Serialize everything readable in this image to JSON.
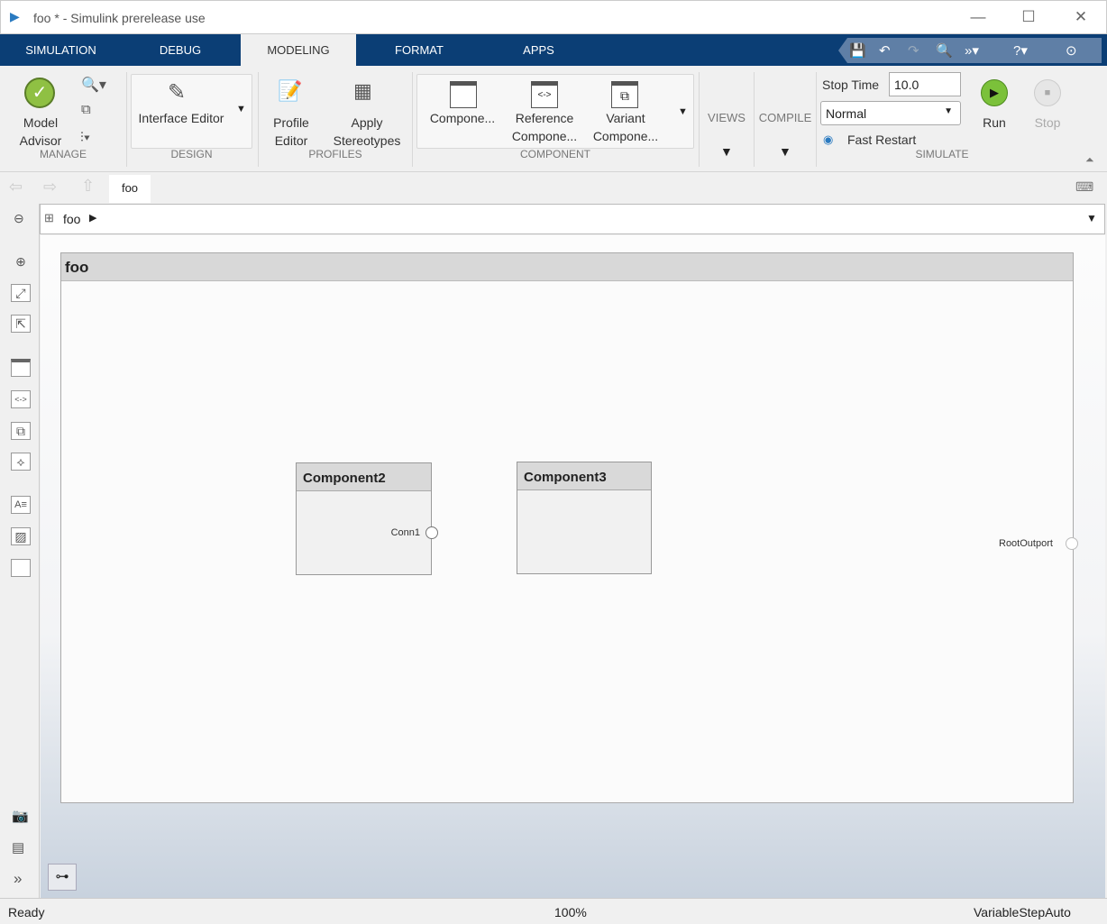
{
  "window": {
    "title": "foo * - Simulink prerelease use"
  },
  "tabs": [
    "SIMULATION",
    "DEBUG",
    "MODELING",
    "FORMAT",
    "APPS"
  ],
  "active_tab": "MODELING",
  "ribbon": {
    "manage": {
      "label": "MANAGE",
      "model_advisor": "Model Advisor"
    },
    "design": {
      "label": "DESIGN",
      "interface_editor": "Interface Editor"
    },
    "profiles": {
      "label": "PROFILES",
      "profile_editor": "Profile Editor",
      "apply_stereotypes": "Apply Stereotypes"
    },
    "component": {
      "label": "COMPONENT",
      "component": "Compone...",
      "reference_l1": "Reference",
      "reference_l2": "Compone...",
      "variant_l1": "Variant",
      "variant_l2": "Compone..."
    },
    "views": "VIEWS",
    "compile": "COMPILE",
    "simulate": {
      "label": "SIMULATE",
      "stop_time_label": "Stop Time",
      "stop_time": "10.0",
      "mode": "Normal",
      "fast_restart": "Fast Restart",
      "run": "Run",
      "stop": "Stop"
    }
  },
  "nav": {
    "tab": "foo"
  },
  "address": {
    "path": "foo"
  },
  "diagram": {
    "title": "foo",
    "components": [
      {
        "name": "Component2",
        "port": "Conn1"
      },
      {
        "name": "Component3"
      }
    ],
    "root_port": "RootOutport"
  },
  "status": {
    "state": "Ready",
    "zoom": "100%",
    "solver": "VariableStepAuto"
  }
}
